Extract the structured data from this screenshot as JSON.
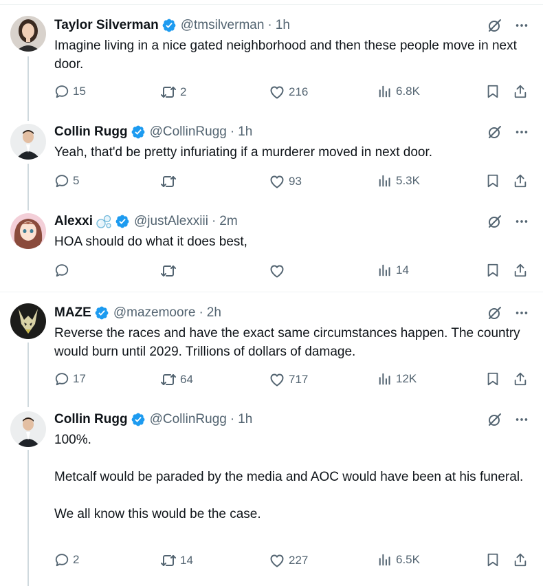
{
  "tweets": [
    {
      "name": "Taylor Silverman",
      "handle": "@tmsilverman",
      "time": "1h",
      "text": [
        "Imagine living in a nice gated neighborhood and then these people move in next door."
      ],
      "replies": "15",
      "retweets": "2",
      "likes": "216",
      "views": "6.8K"
    },
    {
      "name": "Collin Rugg",
      "handle": "@CollinRugg",
      "time": "1h",
      "text": [
        "Yeah, that'd be pretty infuriating if a murderer moved in next door."
      ],
      "replies": "5",
      "retweets": "",
      "likes": "93",
      "views": "5.3K"
    },
    {
      "name": "Alexxi",
      "handle": "@justAlexxiii",
      "time": "2m",
      "text": [
        "HOA should do what it does best,"
      ],
      "replies": "",
      "retweets": "",
      "likes": "",
      "views": "14"
    },
    {
      "name": "MAZE",
      "handle": "@mazemoore",
      "time": "2h",
      "text": [
        "Reverse the races and have the exact same circumstances happen. The country would burn until 2029. Trillions of dollars of damage."
      ],
      "replies": "17",
      "retweets": "64",
      "likes": "717",
      "views": "12K"
    },
    {
      "name": "Collin Rugg",
      "handle": "@CollinRugg",
      "time": "1h",
      "text": [
        "100%.",
        "Metcalf would be paraded by the media and AOC would have been at his funeral.",
        "We all know this would be the case."
      ],
      "replies": "2",
      "retweets": "14",
      "likes": "227",
      "views": "6.5K"
    }
  ],
  "separator": "·",
  "colors": {
    "verified": "#1d9bf0",
    "muted": "#536471",
    "text": "#0f1419",
    "thread_line": "#cfd9de",
    "divider": "#eff3f4"
  },
  "icons": [
    "verified-badge-icon",
    "grok-icon",
    "more-icon",
    "reply-icon",
    "retweet-icon",
    "like-icon",
    "views-icon",
    "bookmark-icon",
    "share-icon",
    "bubbles-emoji-icon"
  ]
}
